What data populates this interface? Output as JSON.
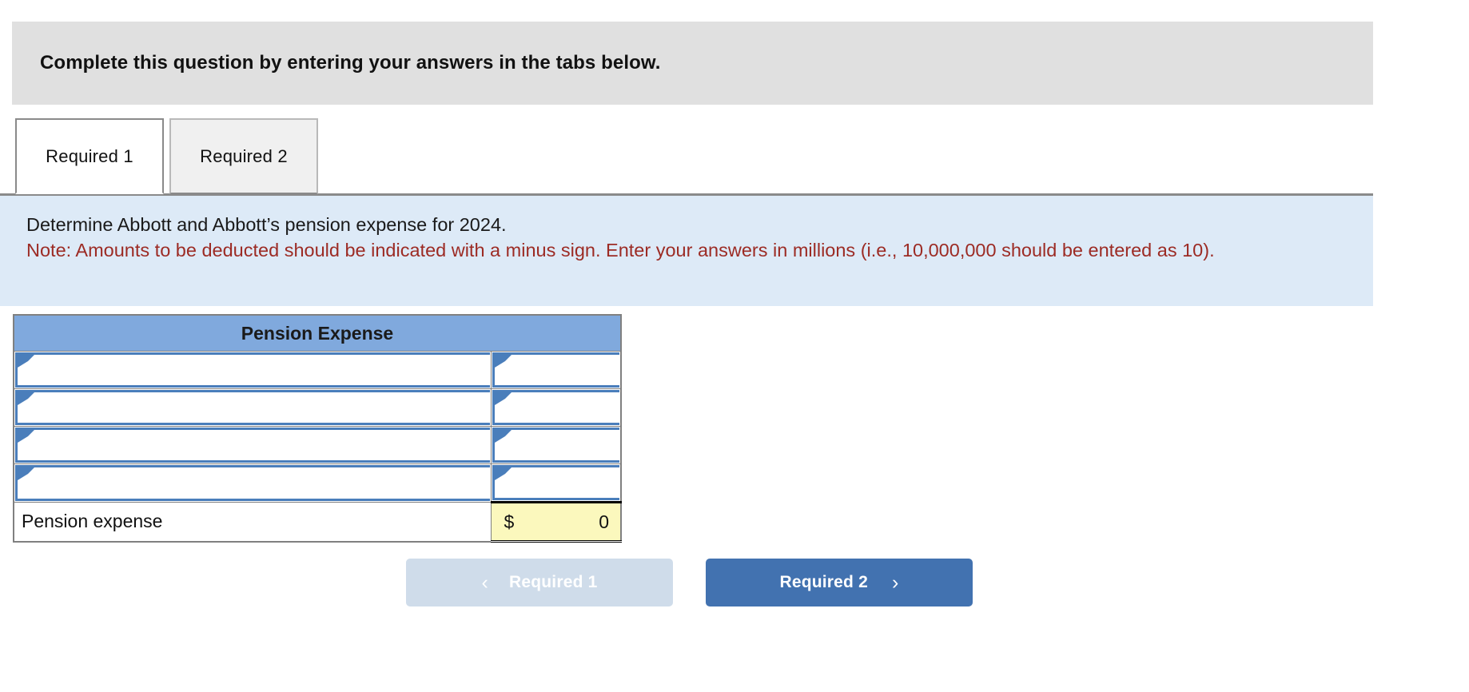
{
  "banner": {
    "text": "Complete this question by entering your answers in the tabs below."
  },
  "tabs": [
    {
      "label": "Required 1",
      "state": "active"
    },
    {
      "label": "Required 2",
      "state": "inactive"
    }
  ],
  "instructions": {
    "main": "Determine Abbott and Abbott’s pension expense for 2024.",
    "note": "Note: Amounts to be deducted should be indicated with a minus sign. Enter your answers in millions (i.e., 10,000,000 should be entered as 10).",
    "background_color": "#ddeaf7",
    "note_color": "#9c2b24"
  },
  "table": {
    "header": "Pension Expense",
    "header_color": "#80a9dd",
    "rows": [
      {
        "label": "",
        "amount": "",
        "type": "input"
      },
      {
        "label": "",
        "amount": "",
        "type": "input"
      },
      {
        "label": "",
        "amount": "",
        "type": "input"
      },
      {
        "label": "",
        "amount": "",
        "type": "input"
      }
    ],
    "total_row": {
      "label": "Pension expense",
      "currency": "$",
      "amount": "0",
      "highlight_color": "#fbf8bd"
    }
  },
  "navigation": {
    "prev": {
      "label": "Required 1",
      "icon": "chevron-left-icon",
      "glyph": "‹",
      "disabled": true,
      "color": "#cfdcea"
    },
    "next": {
      "label": "Required 2",
      "icon": "chevron-right-icon",
      "glyph": "›",
      "disabled": false,
      "color": "#4272b0"
    }
  }
}
